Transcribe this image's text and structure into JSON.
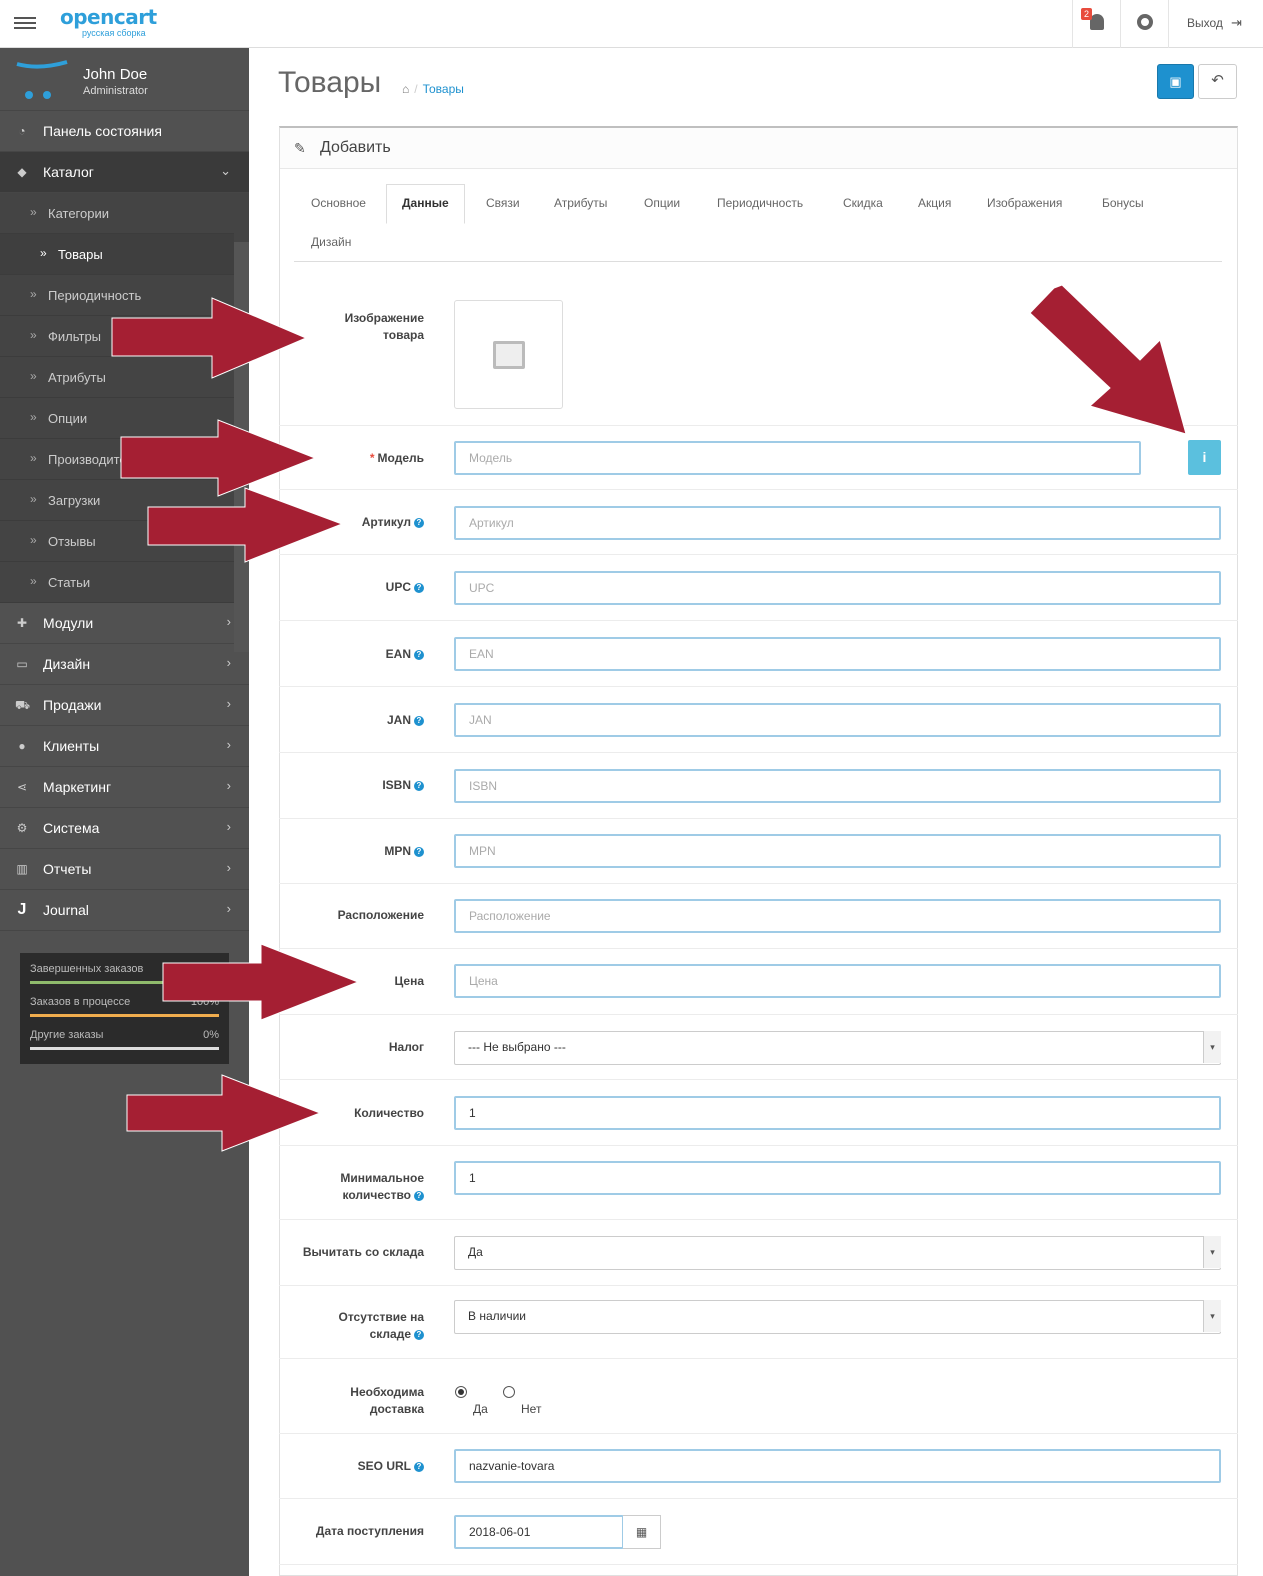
{
  "header": {
    "logo_main": "opencart",
    "logo_sub": "русская сборка",
    "notifications_count": "2",
    "logout_label": "Выход"
  },
  "profile": {
    "name": "John Doe",
    "role": "Administrator"
  },
  "sidebar": {
    "items_top": [
      {
        "label": "Панель состояния",
        "icon": "dashboard-icon"
      },
      {
        "label": "Каталог",
        "icon": "tags-icon"
      }
    ],
    "catalog_sub": [
      {
        "label": "Категории"
      },
      {
        "label": "Товары"
      },
      {
        "label": "Периодичность"
      },
      {
        "label": "Фильтры"
      },
      {
        "label": "Атрибуты"
      },
      {
        "label": "Опции"
      },
      {
        "label": "Производители"
      },
      {
        "label": "Загрузки"
      },
      {
        "label": "Отзывы"
      },
      {
        "label": "Статьи"
      }
    ],
    "items_bottom": [
      {
        "label": "Модули",
        "icon": "puzzle-icon"
      },
      {
        "label": "Дизайн",
        "icon": "desktop-icon"
      },
      {
        "label": "Продажи",
        "icon": "cart-icon"
      },
      {
        "label": "Клиенты",
        "icon": "user-icon"
      },
      {
        "label": "Маркетинг",
        "icon": "share-icon"
      },
      {
        "label": "Система",
        "icon": "gear-icon"
      },
      {
        "label": "Отчеты",
        "icon": "bar-chart-icon"
      },
      {
        "label": "Journal",
        "icon": "journal-icon"
      }
    ],
    "stats": [
      {
        "label": "Завершенных заказов",
        "value": "",
        "percent": 100,
        "color": "#8fbb6c"
      },
      {
        "label": "Заказов в процессе",
        "value": "100%",
        "percent": 100,
        "color": "#f0ad4e"
      },
      {
        "label": "Другие заказы",
        "value": "0%",
        "percent": 0,
        "color": "#dddddd"
      }
    ]
  },
  "page": {
    "title": "Товары",
    "breadcrumb": "Товары",
    "panel_title": "Добавить",
    "tabs": [
      "Основное",
      "Данные",
      "Связи",
      "Атрибуты",
      "Опции",
      "Периодичность",
      "Скидка",
      "Акция",
      "Изображения",
      "Бонусы",
      "Дизайн"
    ],
    "active_tab": "Данные"
  },
  "form": {
    "image_label": "Изображение товара",
    "model_label": "Модель",
    "model_placeholder": "Модель",
    "sku_label": "Артикул",
    "sku_placeholder": "Артикул",
    "upc_label": "UPC",
    "upc_placeholder": "UPC",
    "ean_label": "EAN",
    "ean_placeholder": "EAN",
    "jan_label": "JAN",
    "jan_placeholder": "JAN",
    "isbn_label": "ISBN",
    "isbn_placeholder": "ISBN",
    "mpn_label": "MPN",
    "mpn_placeholder": "MPN",
    "location_label": "Расположение",
    "location_placeholder": "Расположение",
    "price_label": "Цена",
    "price_placeholder": "Цена",
    "tax_label": "Налог",
    "tax_value": "--- Не выбрано ---",
    "quantity_label": "Количество",
    "quantity_value": "1",
    "min_qty_label_1": "Минимальное",
    "min_qty_label_2": "количество",
    "min_qty_value": "1",
    "subtract_label": "Вычитать со склада",
    "subtract_value": "Да",
    "stock_status_label_1": "Отсутствие на",
    "stock_status_label_2": "складе",
    "stock_status_value": "В наличии",
    "shipping_label_1": "Необходима",
    "shipping_label_2": "доставка",
    "shipping_yes": "Да",
    "shipping_no": "Нет",
    "seo_label": "SEO URL",
    "seo_value": "nazvanie-tovara",
    "date_label": "Дата поступления",
    "date_value": "2018-06-01"
  },
  "colors": {
    "accent": "#1e91cf",
    "arrow": "#a51f33",
    "sidebar": "#515151"
  }
}
